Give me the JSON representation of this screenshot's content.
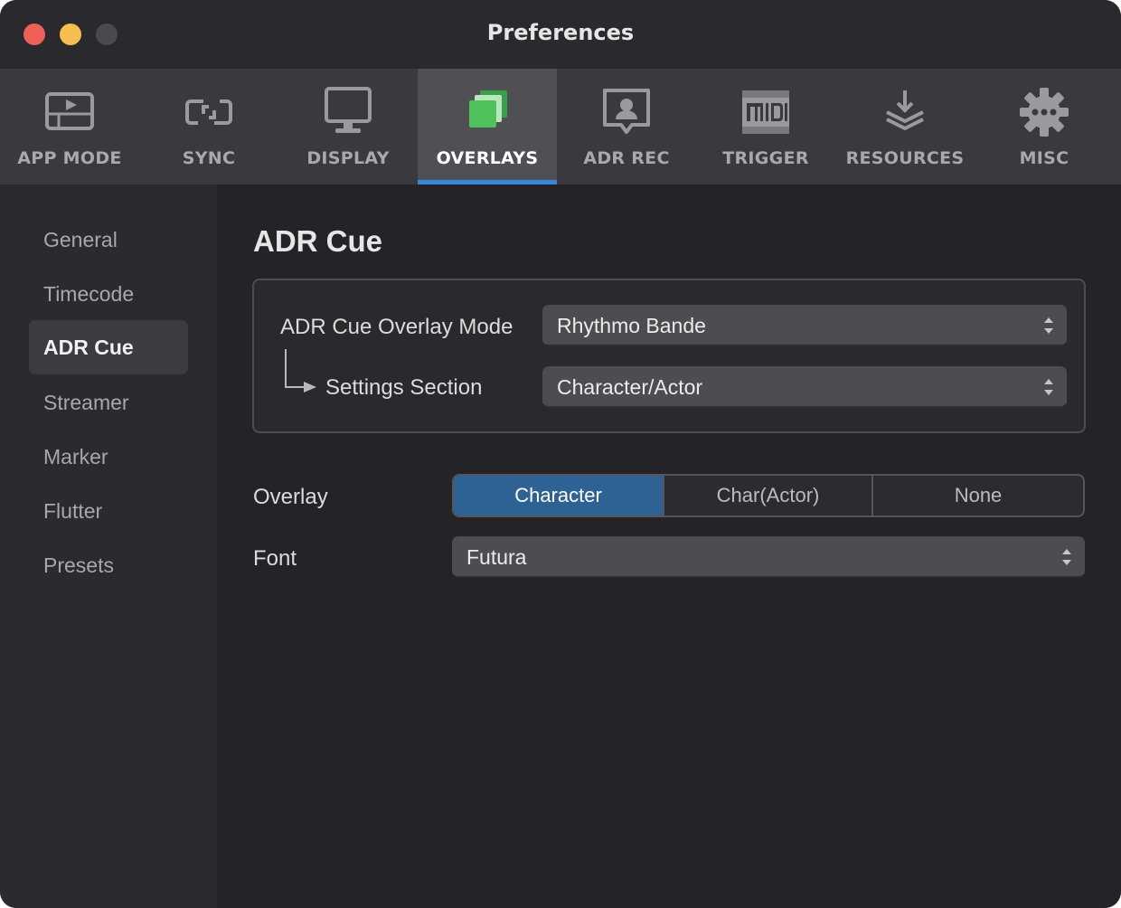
{
  "window": {
    "title": "Preferences"
  },
  "toolbar": {
    "tabs": [
      {
        "label": "APP MODE",
        "icon": "app-mode-icon"
      },
      {
        "label": "SYNC",
        "icon": "sync-icon"
      },
      {
        "label": "DISPLAY",
        "icon": "display-icon"
      },
      {
        "label": "OVERLAYS",
        "icon": "overlays-icon",
        "active": true
      },
      {
        "label": "ADR REC",
        "icon": "adr-rec-icon"
      },
      {
        "label": "TRIGGER",
        "icon": "midi-icon"
      },
      {
        "label": "RESOURCES",
        "icon": "resources-icon"
      },
      {
        "label": "MISC",
        "icon": "gear-icon"
      }
    ],
    "accent": "#3a86d8"
  },
  "sidebar": {
    "items": [
      {
        "label": "General"
      },
      {
        "label": "Timecode"
      },
      {
        "label": "ADR Cue",
        "active": true
      },
      {
        "label": "Streamer"
      },
      {
        "label": "Marker"
      },
      {
        "label": "Flutter"
      },
      {
        "label": "Presets"
      }
    ]
  },
  "main": {
    "heading": "ADR Cue",
    "overlay_mode": {
      "label": "ADR Cue Overlay Mode",
      "value": "Rhythmo Bande"
    },
    "settings_section": {
      "label": "Settings Section",
      "value": "Character/Actor"
    },
    "overlay": {
      "label": "Overlay",
      "options": [
        "Character",
        "Char(Actor)",
        "None"
      ],
      "selected": "Character",
      "selected_color": "#2e6295"
    },
    "font": {
      "label": "Font",
      "value": "Futura"
    }
  }
}
